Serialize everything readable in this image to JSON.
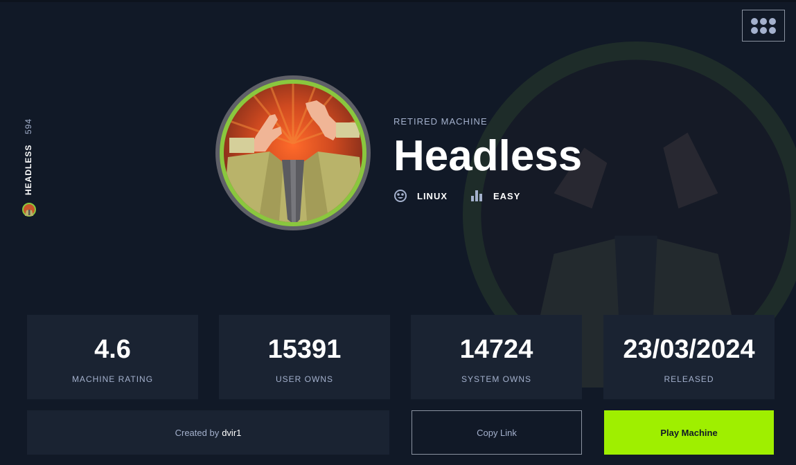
{
  "machine": {
    "name": "Headless",
    "status": "RETIRED MACHINE",
    "side_name": "HEADLESS",
    "side_count": "594",
    "os": "LINUX",
    "difficulty": "EASY"
  },
  "stats": [
    {
      "value": "4.6",
      "label": "MACHINE RATING"
    },
    {
      "value": "15391",
      "label": "USER OWNS"
    },
    {
      "value": "14724",
      "label": "SYSTEM OWNS"
    },
    {
      "value": "23/03/2024",
      "label": "RELEASED"
    }
  ],
  "actions": {
    "created_prefix": "Created by",
    "creator": "dvir1",
    "copy_link": "Copy Link",
    "play": "Play Machine"
  },
  "icons": {
    "menu": "grid-dots-icon",
    "os": "linux-icon",
    "difficulty": "bar-chart-icon"
  },
  "colors": {
    "background": "#111927",
    "card": "#1a2332",
    "accent": "#9fef00",
    "avatar_ring": "#8ac73e",
    "muted_text": "#a4b1cd"
  }
}
